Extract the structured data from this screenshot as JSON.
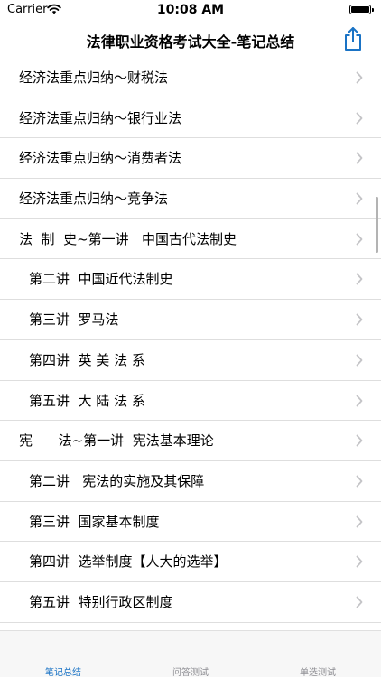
{
  "status": {
    "carrier": "Carrier",
    "time": "10:08 AM"
  },
  "nav": {
    "title": "法律职业资格考试大全-笔记总结"
  },
  "list": {
    "items": [
      {
        "label": "经济法重点归纳～财税法",
        "indent": false
      },
      {
        "label": "经济法重点归纳～银行业法",
        "indent": false
      },
      {
        "label": "经济法重点归纳～消费者法",
        "indent": false
      },
      {
        "label": "经济法重点归纳～竞争法",
        "indent": false
      },
      {
        "label": "法  制  史~第一讲   中国古代法制史",
        "indent": false
      },
      {
        "label": "第二讲  中国近代法制史",
        "indent": true
      },
      {
        "label": "第三讲  罗马法",
        "indent": true
      },
      {
        "label": "第四讲  英 美 法 系",
        "indent": true
      },
      {
        "label": "第五讲  大 陆 法 系",
        "indent": true
      },
      {
        "label": "宪      法~第一讲  宪法基本理论",
        "indent": false
      },
      {
        "label": "第二讲   宪法的实施及其保障",
        "indent": true
      },
      {
        "label": "第三讲  国家基本制度",
        "indent": true
      },
      {
        "label": "第四讲  选举制度【人大的选举】",
        "indent": true
      },
      {
        "label": "第五讲  特别行政区制度",
        "indent": true
      }
    ]
  },
  "tabs": [
    {
      "label": "笔记总结",
      "active": true
    },
    {
      "label": "问答测试",
      "active": false
    },
    {
      "label": "单选测试",
      "active": false
    }
  ],
  "colors": {
    "accent": "#1a73c5",
    "chevron": "#c4c4c7",
    "separator": "#dedede"
  }
}
